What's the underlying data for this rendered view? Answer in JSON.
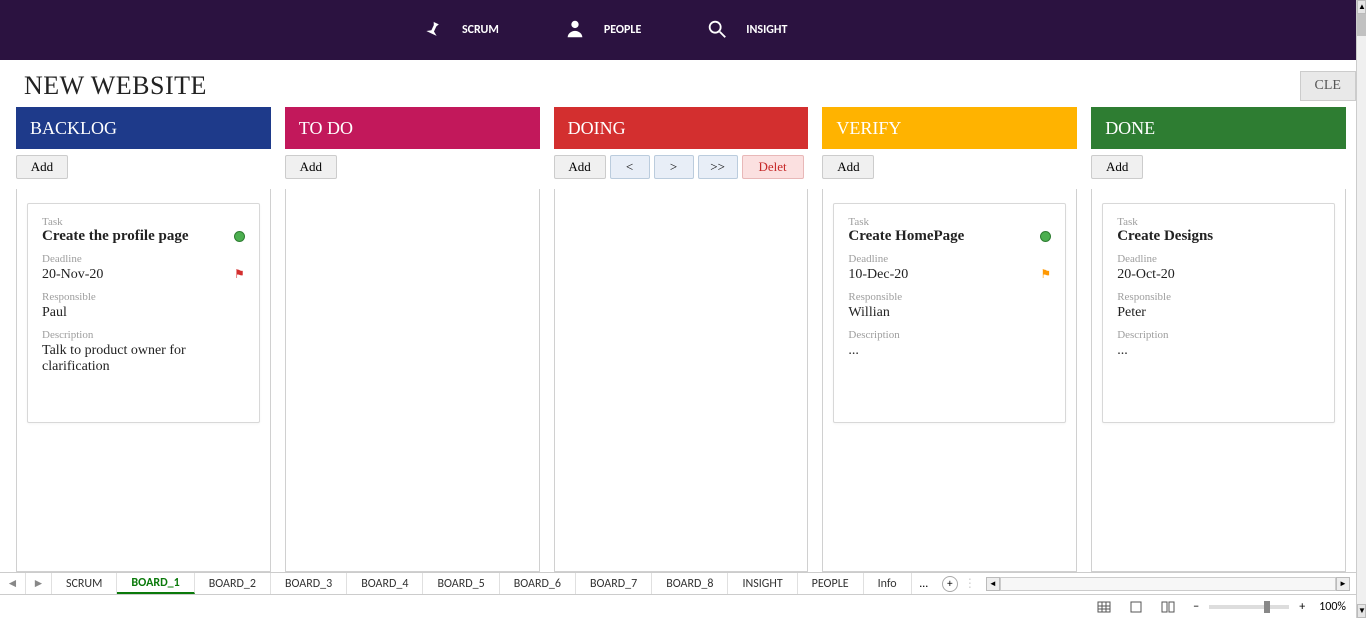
{
  "nav": [
    {
      "id": "scrum",
      "label": "SCRUM",
      "icon": "pin"
    },
    {
      "id": "people",
      "label": "PEOPLE",
      "icon": "person"
    },
    {
      "id": "insight",
      "label": "INSIGHT",
      "icon": "search"
    }
  ],
  "page_title": "NEW WEBSITE",
  "right_button": "CLE",
  "columns": [
    {
      "id": "backlog",
      "title": "BACKLOG",
      "headClass": "h-backlog",
      "buttons": [
        {
          "label": "Add",
          "type": "add"
        }
      ],
      "cards": [
        {
          "task_label": "Task",
          "task": "Create the profile page",
          "dot": true,
          "deadline_label": "Deadline",
          "deadline": "20-Nov-20",
          "flag": "#d32f2f",
          "responsible_label": "Responsible",
          "responsible": "Paul",
          "description_label": "Description",
          "description": "Talk to product owner for clarification"
        }
      ]
    },
    {
      "id": "todo",
      "title": "TO DO",
      "headClass": "h-todo",
      "buttons": [
        {
          "label": "Add",
          "type": "add"
        }
      ],
      "cards": []
    },
    {
      "id": "doing",
      "title": "DOING",
      "headClass": "h-doing",
      "buttons": [
        {
          "label": "Add",
          "type": "add"
        },
        {
          "label": "<",
          "type": "nav"
        },
        {
          "label": ">",
          "type": "nav"
        },
        {
          "label": ">>",
          "type": "nav"
        },
        {
          "label": "Delet",
          "type": "del"
        }
      ],
      "cards": []
    },
    {
      "id": "verify",
      "title": "VERIFY",
      "headClass": "h-verify",
      "buttons": [
        {
          "label": "Add",
          "type": "add"
        }
      ],
      "cards": [
        {
          "task_label": "Task",
          "task": "Create HomePage",
          "dot": true,
          "deadline_label": "Deadline",
          "deadline": "10-Dec-20",
          "flag": "#ff9800",
          "responsible_label": "Responsible",
          "responsible": "Willian",
          "description_label": "Description",
          "description": "..."
        }
      ]
    },
    {
      "id": "done",
      "title": "DONE",
      "headClass": "h-done",
      "buttons": [
        {
          "label": "Add",
          "type": "add"
        }
      ],
      "cards": [
        {
          "task_label": "Task",
          "task": "Create Designs",
          "dot": false,
          "deadline_label": "Deadline",
          "deadline": "20-Oct-20",
          "flag": null,
          "responsible_label": "Responsible",
          "responsible": "Peter",
          "description_label": "Description",
          "description": "..."
        }
      ]
    }
  ],
  "tabs": {
    "items": [
      "SCRUM",
      "BOARD_1",
      "BOARD_2",
      "BOARD_3",
      "BOARD_4",
      "BOARD_5",
      "BOARD_6",
      "BOARD_7",
      "BOARD_8",
      "INSIGHT",
      "PEOPLE",
      "Info"
    ],
    "active": "BOARD_1"
  },
  "zoom": "100%"
}
